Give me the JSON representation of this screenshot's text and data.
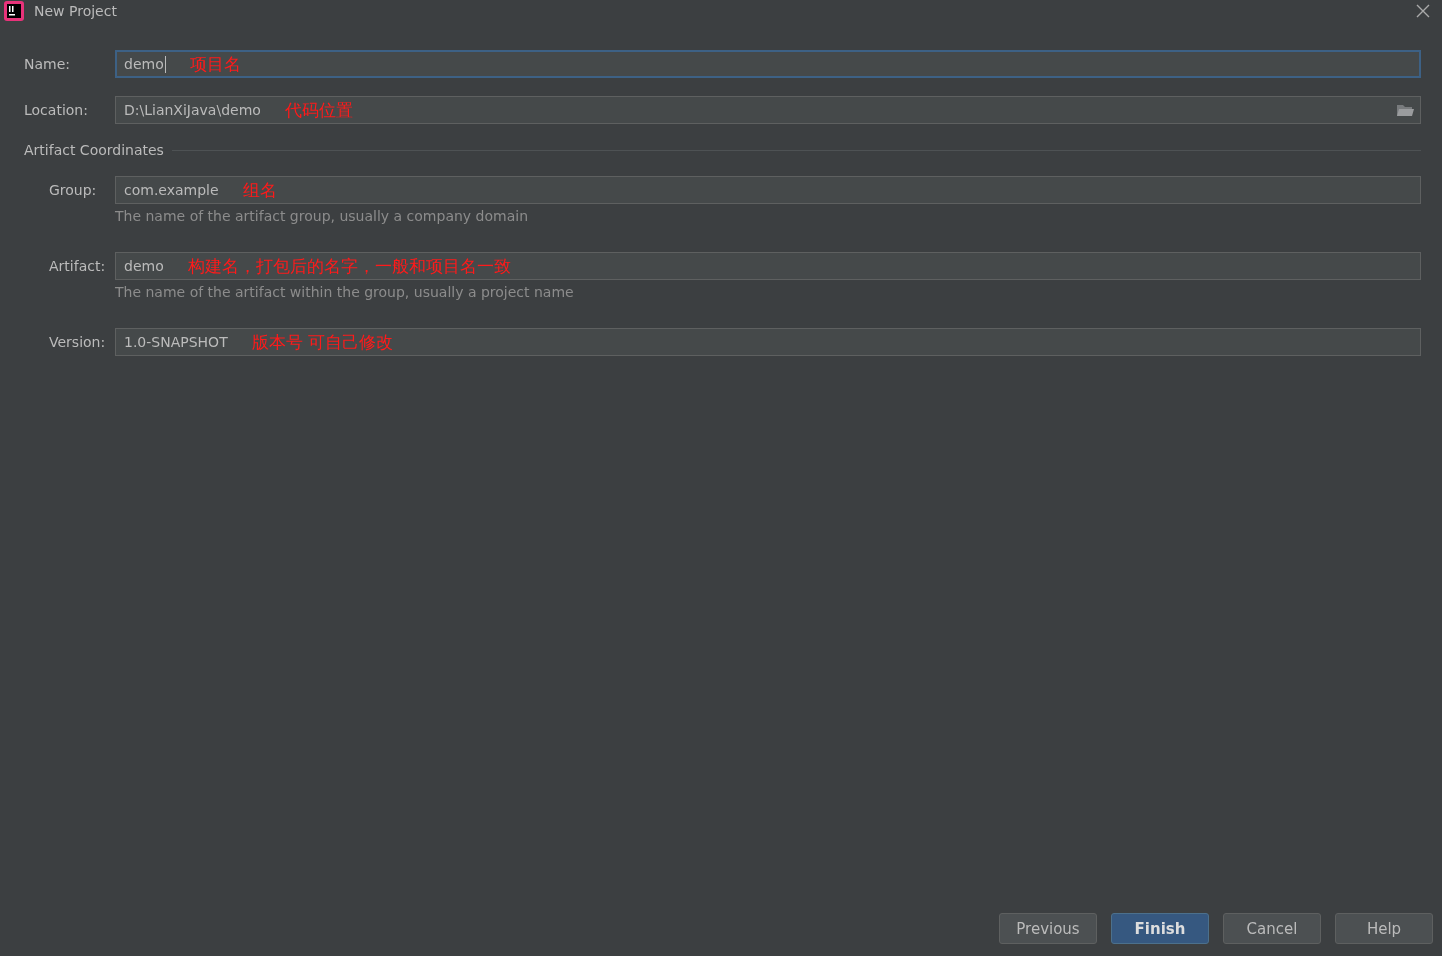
{
  "window": {
    "title": "New Project"
  },
  "fields": [
    {
      "label": "Name:",
      "value": "demo",
      "annotation": "项目名",
      "focused": true,
      "indented": false
    },
    {
      "label": "Location:",
      "value": "D:\\LianXiJava\\demo",
      "annotation": "代码位置",
      "focused": false,
      "indented": false,
      "browse": true
    }
  ],
  "section": {
    "title": "Artifact Coordinates",
    "fields": [
      {
        "label": "Group:",
        "value": "com.example",
        "annotation": "组名",
        "focused": false,
        "indented": true,
        "hint": "The name of the artifact group, usually a company domain"
      },
      {
        "label": "Artifact:",
        "value": "demo",
        "annotation": "构建名，打包后的名字，一般和项目名一致",
        "focused": false,
        "indented": true,
        "hint": "The name of the artifact within the group, usually a project name"
      },
      {
        "label": "Version:",
        "value": "1.0-SNAPSHOT",
        "annotation": "版本号 可自己修改",
        "focused": false,
        "indented": true
      }
    ]
  },
  "buttons": [
    {
      "label": "Previous",
      "kind": "default"
    },
    {
      "label": "Finish",
      "kind": "primary"
    },
    {
      "label": "Cancel",
      "kind": "default"
    },
    {
      "label": "Help",
      "kind": "default"
    }
  ]
}
